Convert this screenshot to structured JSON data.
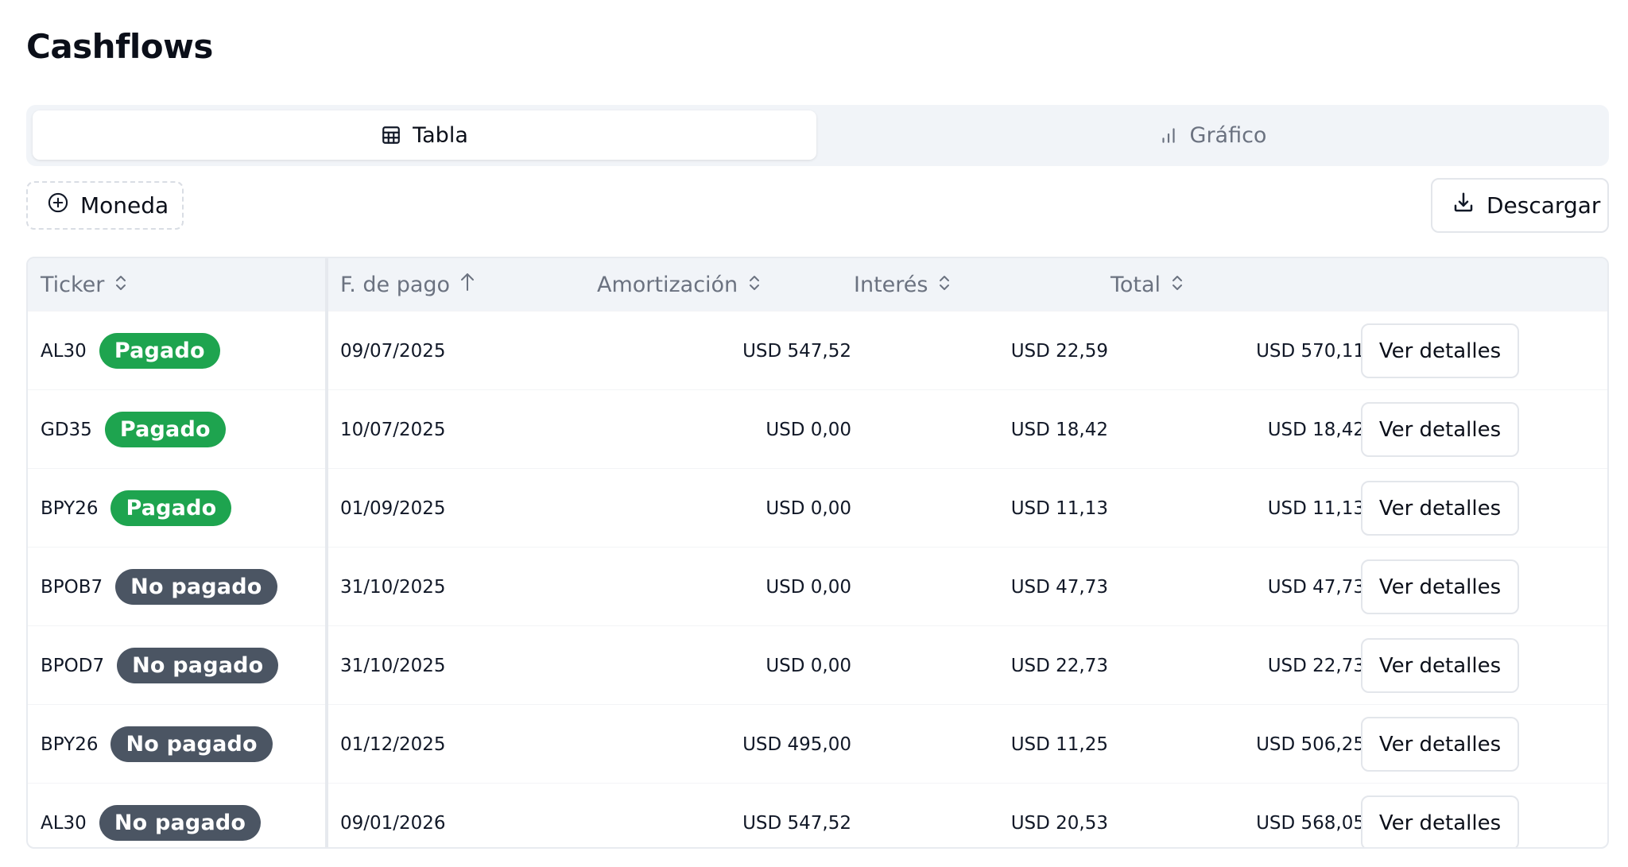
{
  "page": {
    "title": "Cashflows"
  },
  "tabs": [
    {
      "label": "Tabla",
      "icon": "table-icon",
      "active": true
    },
    {
      "label": "Gráfico",
      "icon": "bar-chart-icon",
      "active": false
    }
  ],
  "toolbar": {
    "currency_label": "Moneda",
    "currency_icon": "plus-circle-icon",
    "download_label": "Descargar",
    "download_icon": "download-icon"
  },
  "table": {
    "columns": [
      {
        "label": "Ticker",
        "sort": "none"
      },
      {
        "label": "F. de pago",
        "sort": "asc"
      },
      {
        "label": "Amortización",
        "sort": "none"
      },
      {
        "label": "Interés",
        "sort": "none"
      },
      {
        "label": "Total",
        "sort": "none"
      }
    ],
    "details_label": "Ver detalles",
    "rows": [
      {
        "ticker": "AL30",
        "status": "Pagado",
        "paid": true,
        "date": "09/07/2025",
        "amortization": "USD 547,52",
        "interest": "USD 22,59",
        "total": "USD 570,11"
      },
      {
        "ticker": "GD35",
        "status": "Pagado",
        "paid": true,
        "date": "10/07/2025",
        "amortization": "USD 0,00",
        "interest": "USD 18,42",
        "total": "USD 18,42"
      },
      {
        "ticker": "BPY26",
        "status": "Pagado",
        "paid": true,
        "date": "01/09/2025",
        "amortization": "USD 0,00",
        "interest": "USD 11,13",
        "total": "USD 11,13"
      },
      {
        "ticker": "BPOB7",
        "status": "No pagado",
        "paid": false,
        "date": "31/10/2025",
        "amortization": "USD 0,00",
        "interest": "USD 47,73",
        "total": "USD 47,73"
      },
      {
        "ticker": "BPOD7",
        "status": "No pagado",
        "paid": false,
        "date": "31/10/2025",
        "amortization": "USD 0,00",
        "interest": "USD 22,73",
        "total": "USD 22,73"
      },
      {
        "ticker": "BPY26",
        "status": "No pagado",
        "paid": false,
        "date": "01/12/2025",
        "amortization": "USD 495,00",
        "interest": "USD 11,25",
        "total": "USD 506,25"
      },
      {
        "ticker": "AL30",
        "status": "No pagado",
        "paid": false,
        "date": "09/01/2026",
        "amortization": "USD 547,52",
        "interest": "USD 20,53",
        "total": "USD 568,05"
      }
    ]
  },
  "colors": {
    "paid_badge": "#1ea44f",
    "unpaid_badge": "#4b5563",
    "header_bg": "#f1f4f8"
  }
}
